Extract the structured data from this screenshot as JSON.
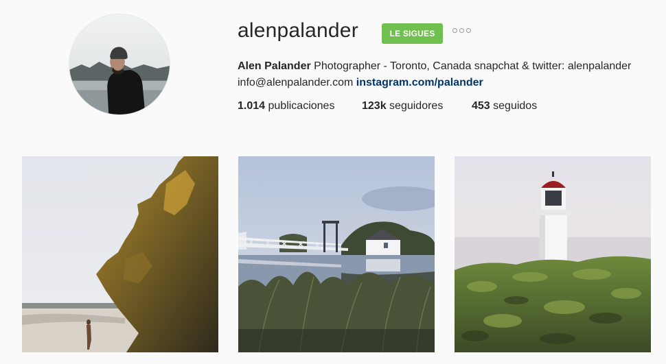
{
  "profile": {
    "username": "alenpalander",
    "follow_button_label": "LE SIGUES",
    "options_icon": "more-options-icon",
    "avatar_alt": "Alen Palander profile picture",
    "bio": {
      "full_name": "Alen Palander",
      "text": " Photographer - Toronto, Canada snapchat & twitter: alenpalander info@alenpalander.com ",
      "link": "instagram.com/palander"
    },
    "stats": {
      "posts_count": "1.014",
      "posts_label": " publicaciones",
      "followers_count": "123k",
      "followers_label": " seguidores",
      "following_count": "453",
      "following_label": " seguidos"
    }
  },
  "posts": [
    {
      "subject": "coastal rock cliff with person on beach"
    },
    {
      "subject": "white bridge and house reflected in lake"
    },
    {
      "subject": "white lighthouse on green hill"
    }
  ],
  "colors": {
    "follow_button": "#70c050",
    "link": "#003569",
    "background": "#fafafa",
    "text": "#262626"
  }
}
